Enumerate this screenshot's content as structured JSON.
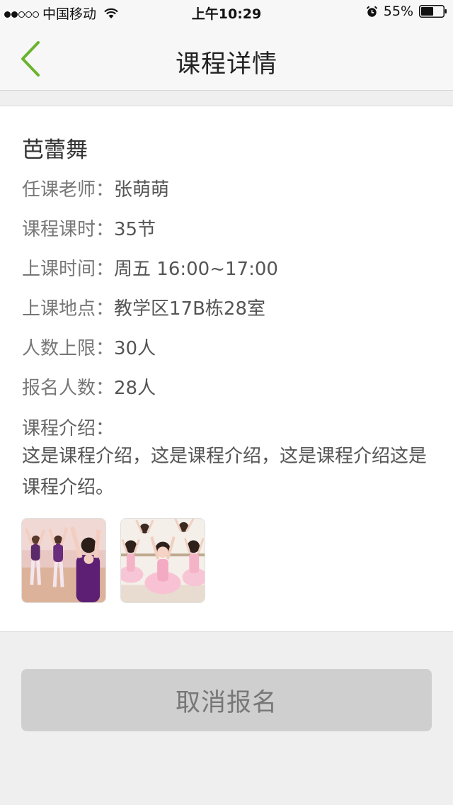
{
  "status_bar": {
    "carrier": "中国移动",
    "time": "上午10:29",
    "battery": "55%",
    "signal_filled": 2,
    "signal_total": 5
  },
  "nav": {
    "title": "课程详情",
    "back_icon": "chevron-left-icon",
    "accent_color": "#6ab42d"
  },
  "course": {
    "name": "芭蕾舞",
    "teacher": {
      "label": "任课老师：",
      "value": "张萌萌"
    },
    "hours": {
      "label": "课程课时：",
      "value": "35节"
    },
    "schedule": {
      "label": "上课时间：",
      "value": "周五 16:00~17:00"
    },
    "location": {
      "label": "上课地点：",
      "value": "教学区17B栋28室"
    },
    "capacity": {
      "label": "人数上限：",
      "value": "30人"
    },
    "enrolled": {
      "label": "报名人数：",
      "value": "28人"
    },
    "intro_label": "课程介绍：",
    "intro_text": "这是课程介绍，这是课程介绍，这是课程介绍这是课程介绍。",
    "photos": [
      "ballet-dancers-purple-photo",
      "ballet-girls-pink-tutu-photo"
    ]
  },
  "actions": {
    "cancel_label": "取消报名"
  }
}
